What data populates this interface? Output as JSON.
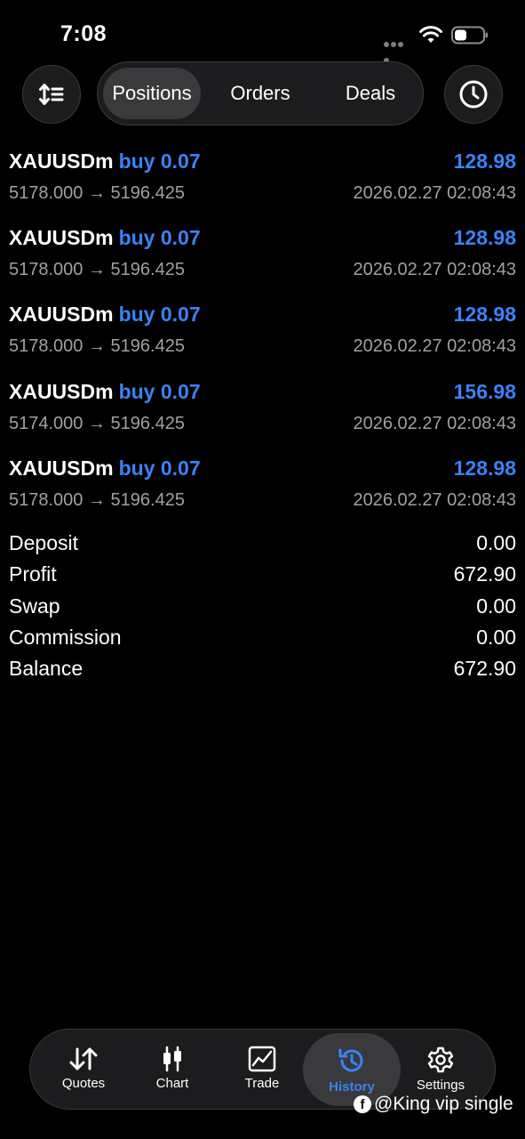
{
  "status_bar": {
    "time": "7:08"
  },
  "tabs": [
    {
      "label": "Positions",
      "active": true
    },
    {
      "label": "Orders",
      "active": false
    },
    {
      "label": "Deals",
      "active": false
    }
  ],
  "deals": [
    {
      "symbol": "XAUUSDm",
      "side": "buy 0.07",
      "profit": "128.98",
      "prices": "5178.000 → 5196.425",
      "time": "2026.02.27 02:08:43"
    },
    {
      "symbol": "XAUUSDm",
      "side": "buy 0.07",
      "profit": "128.98",
      "prices": "5178.000 → 5196.425",
      "time": "2026.02.27 02:08:43"
    },
    {
      "symbol": "XAUUSDm",
      "side": "buy 0.07",
      "profit": "128.98",
      "prices": "5178.000 → 5196.425",
      "time": "2026.02.27 02:08:43"
    },
    {
      "symbol": "XAUUSDm",
      "side": "buy 0.07",
      "profit": "156.98",
      "prices": "5174.000 → 5196.425",
      "time": "2026.02.27 02:08:43"
    },
    {
      "symbol": "XAUUSDm",
      "side": "buy 0.07",
      "profit": "128.98",
      "prices": "5178.000 → 5196.425",
      "time": "2026.02.27 02:08:43"
    }
  ],
  "summary": [
    {
      "label": "Deposit",
      "value": "0.00"
    },
    {
      "label": "Profit",
      "value": "672.90"
    },
    {
      "label": "Swap",
      "value": "0.00"
    },
    {
      "label": "Commission",
      "value": "0.00"
    },
    {
      "label": "Balance",
      "value": "672.90"
    }
  ],
  "bottom_nav": [
    {
      "label": "Quotes",
      "icon": "quotes-icon",
      "active": false
    },
    {
      "label": "Chart",
      "icon": "chart-icon",
      "active": false
    },
    {
      "label": "Trade",
      "icon": "trade-icon",
      "active": false
    },
    {
      "label": "History",
      "icon": "history-icon",
      "active": true
    },
    {
      "label": "Settings",
      "icon": "settings-icon",
      "active": false
    }
  ],
  "watermark": {
    "text": "@King vip single",
    "icon": "facebook-icon"
  },
  "colors": {
    "accent": "#3a82f7",
    "background": "#000000",
    "muted": "#a0a0a5",
    "panel": "#1c1c1e"
  }
}
